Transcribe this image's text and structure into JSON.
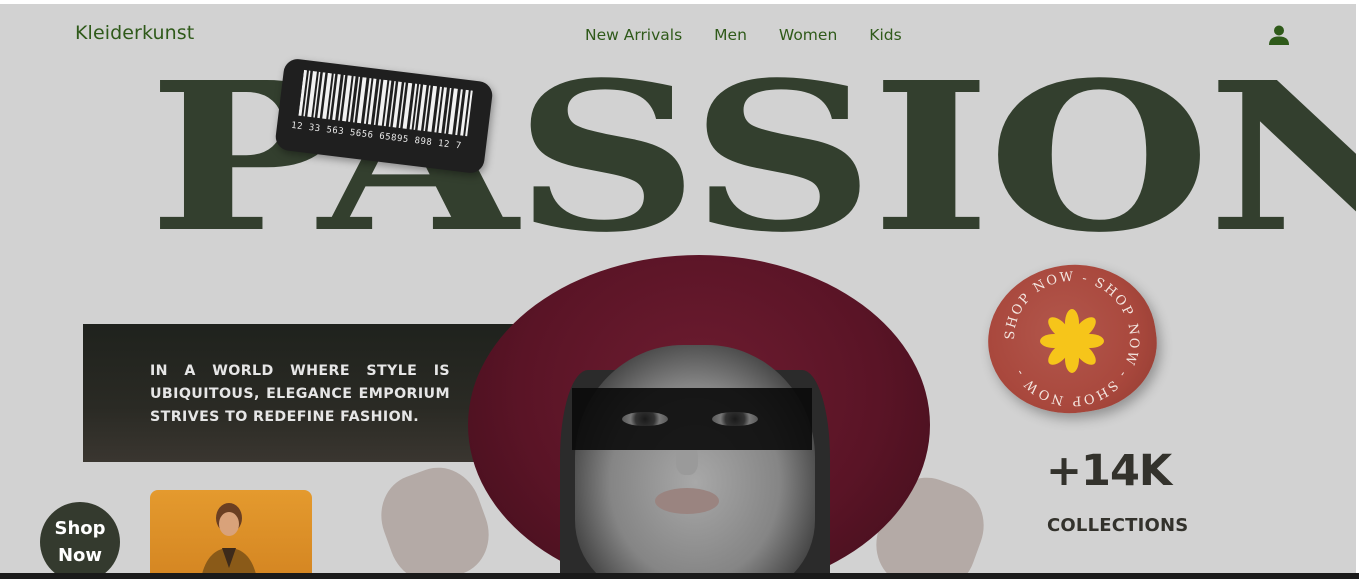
{
  "brand": {
    "name": "Kleiderkunst",
    "color": "#2f5a1a"
  },
  "nav": {
    "items": [
      {
        "label": "New Arrivals"
      },
      {
        "label": "Men"
      },
      {
        "label": "Women"
      },
      {
        "label": "Kids"
      }
    ],
    "account_icon": "user-icon"
  },
  "hero": {
    "headline": "PASSION",
    "barcode_number": "12 33 563 5656 65895 898 12 7",
    "tagline": "IN A WORLD WHERE STYLE IS UBIQUITOUS, ELEGANCE EMPORIUM STRIVES TO REDEFINE FASHION.",
    "sticker_text": "SHOP NOW - SHOP NOW - SHOP NOW -",
    "stat_value": "+14K",
    "stat_label": "COLLECTIONS",
    "headline_color": "#333f2e",
    "hat_color": "#5a1426",
    "sticker_color": "#a9483d",
    "flower_color": "#f6c51a"
  },
  "cta": {
    "shop_now_line1": "Shop",
    "shop_now_line2": "Now"
  }
}
